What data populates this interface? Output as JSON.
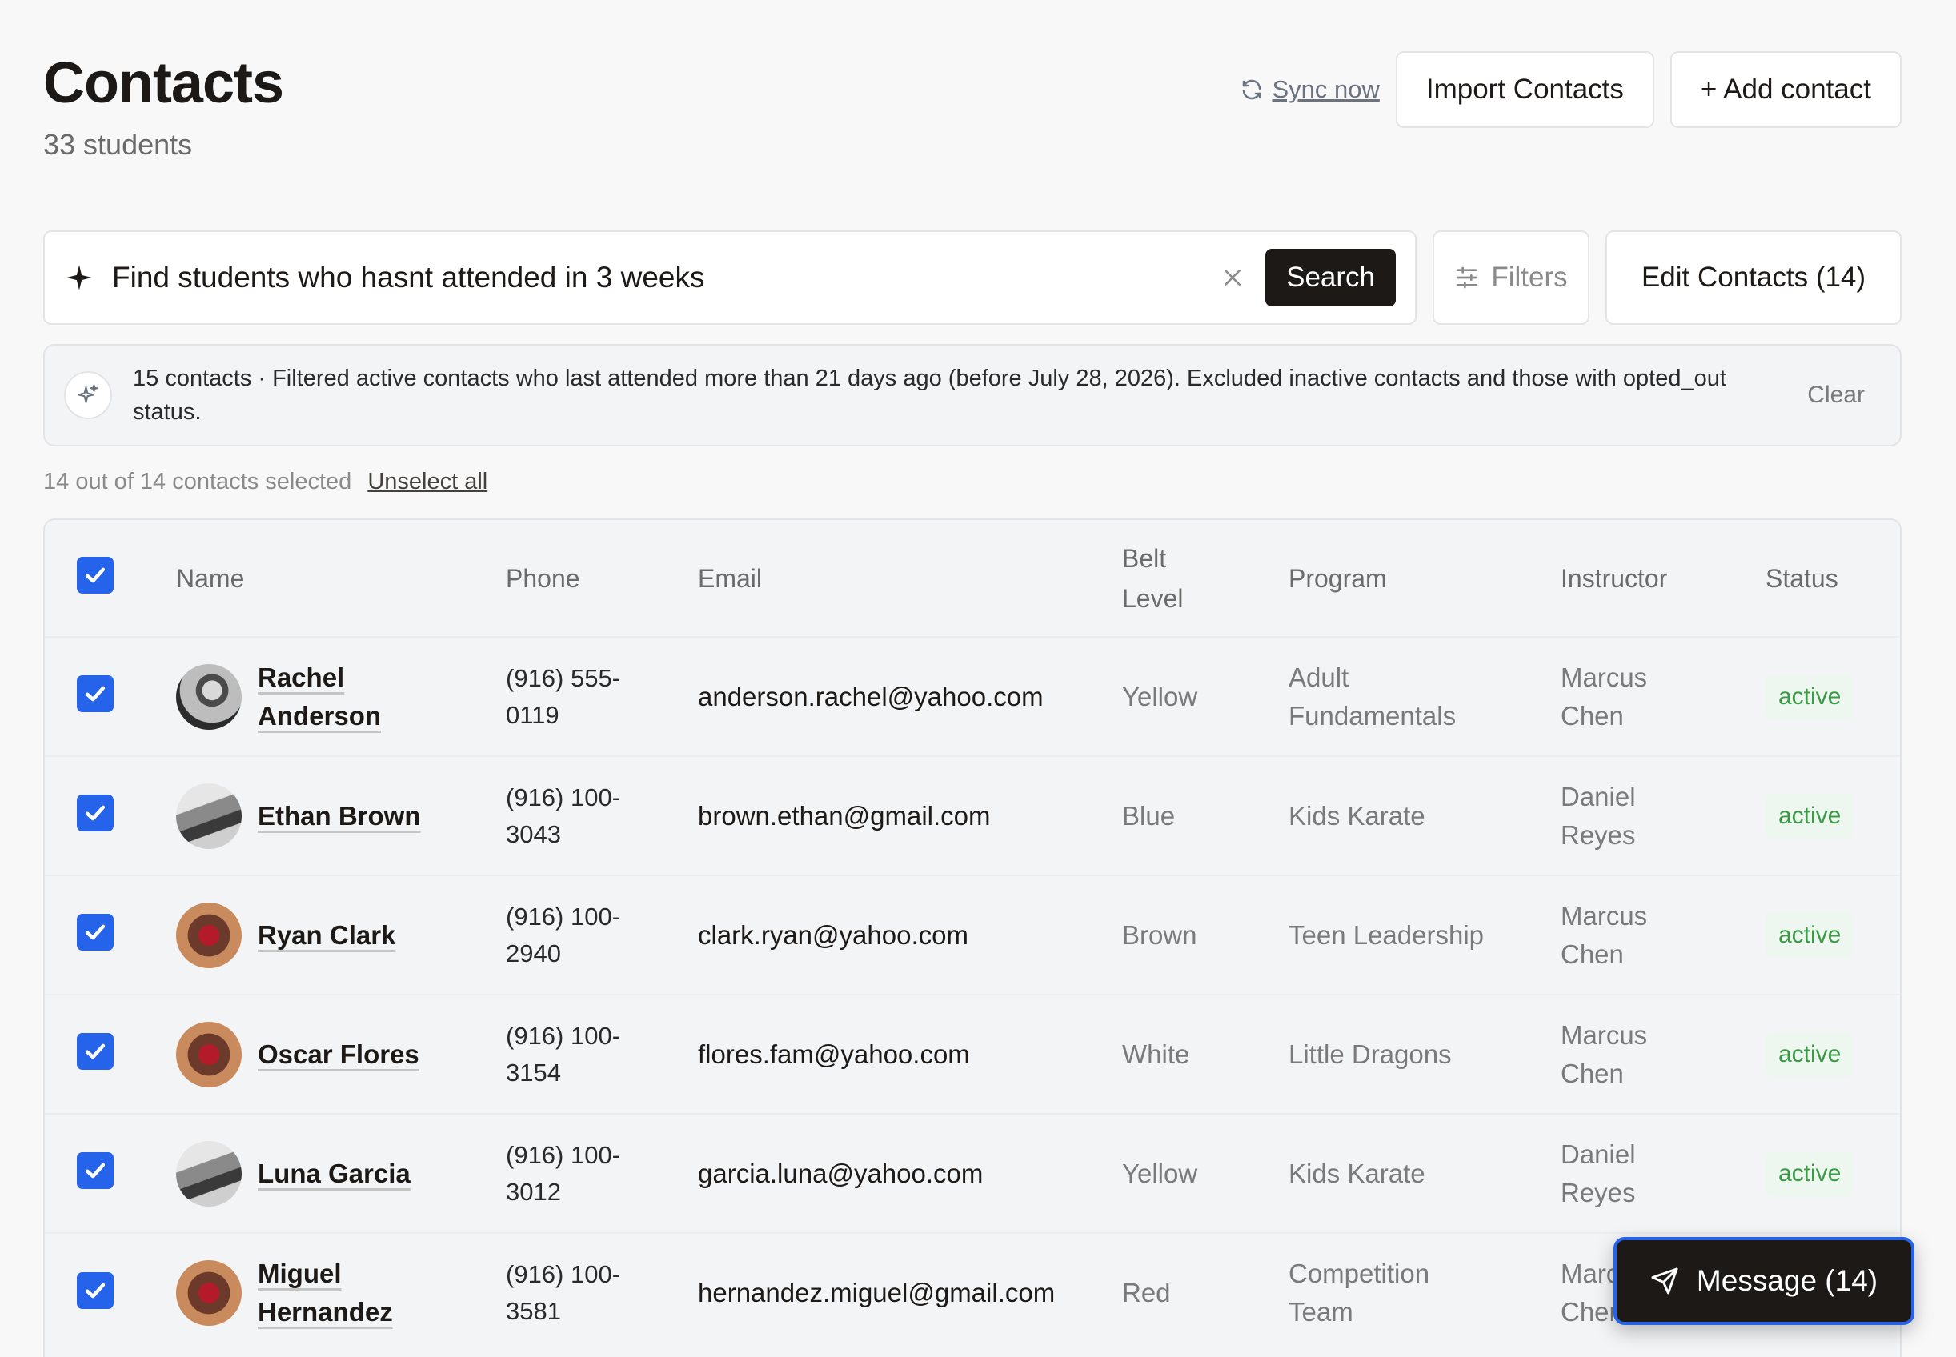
{
  "header": {
    "title": "Contacts",
    "subtitle": "33 students"
  },
  "actions": {
    "sync": "Sync now",
    "import": "Import Contacts",
    "add": "+ Add contact"
  },
  "search": {
    "query": "Find students who hasnt attended in 3 weeks",
    "button": "Search",
    "filters": "Filters",
    "edit": "Edit Contacts (14)"
  },
  "ai_banner": {
    "text": "15 contacts · Filtered active contacts who last attended more than 21 days ago (before July 28, 2026). Excluded inactive contacts and those with opted_out status.",
    "clear": "Clear"
  },
  "selection": {
    "summary": "14 out of 14 contacts selected",
    "unselect": "Unselect all"
  },
  "table": {
    "columns": {
      "name": "Name",
      "phone": "Phone",
      "email": "Email",
      "belt_line1": "Belt",
      "belt_line2": "Level",
      "program": "Program",
      "instructor": "Instructor",
      "status": "Status"
    },
    "rows": [
      {
        "name1": "Rachel",
        "name2": "Anderson",
        "phone1": "(916) 555-",
        "phone2": "0119",
        "email": "anderson.rachel@yahoo.com",
        "belt": "Yellow",
        "program1": "Adult",
        "program2": "Fundamentals",
        "instructor1": "Marcus",
        "instructor2": "Chen",
        "status": "active"
      },
      {
        "name1": "Ethan Brown",
        "name2": "",
        "phone1": "(916) 100-",
        "phone2": "3043",
        "email": "brown.ethan@gmail.com",
        "belt": "Blue",
        "program1": "Kids Karate",
        "program2": "",
        "instructor1": "Daniel",
        "instructor2": "Reyes",
        "status": "active"
      },
      {
        "name1": "Ryan Clark",
        "name2": "",
        "phone1": "(916) 100-",
        "phone2": "2940",
        "email": "clark.ryan@yahoo.com",
        "belt": "Brown",
        "program1": "Teen Leadership",
        "program2": "",
        "instructor1": "Marcus",
        "instructor2": "Chen",
        "status": "active"
      },
      {
        "name1": "Oscar Flores",
        "name2": "",
        "phone1": "(916) 100-",
        "phone2": "3154",
        "email": "flores.fam@yahoo.com",
        "belt": "White",
        "program1": "Little Dragons",
        "program2": "",
        "instructor1": "Marcus",
        "instructor2": "Chen",
        "status": "active"
      },
      {
        "name1": "Luna Garcia",
        "name2": "",
        "phone1": "(916) 100-",
        "phone2": "3012",
        "email": "garcia.luna@yahoo.com",
        "belt": "Yellow",
        "program1": "Kids Karate",
        "program2": "",
        "instructor1": "Daniel",
        "instructor2": "Reyes",
        "status": "active"
      },
      {
        "name1": "Miguel",
        "name2": "Hernandez",
        "phone1": "(916) 100-",
        "phone2": "3581",
        "email": "hernandez.miguel@gmail.com",
        "belt": "Red",
        "program1": "Competition",
        "program2": "Team",
        "instructor1": "Marcus",
        "instructor2": "Chen",
        "status": "active"
      }
    ]
  },
  "message_button": "Message (14)",
  "colors": {
    "primary": "#1c1917",
    "checkbox": "#2563eb",
    "active_text": "#3b9a46",
    "active_bg": "#eef7ef",
    "background": "#f8f8f9"
  }
}
